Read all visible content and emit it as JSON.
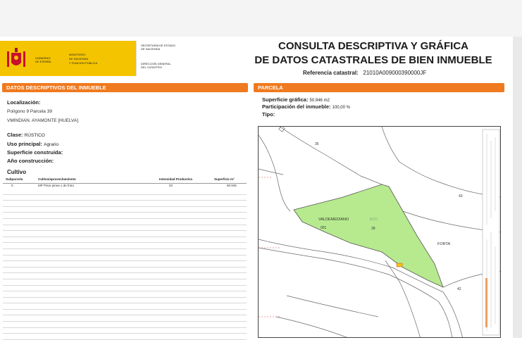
{
  "header": {
    "gov_line1": "GOBIERNO",
    "gov_line2": "DE ESPAÑA",
    "ministry_line1": "MINISTERIO",
    "ministry_line2": "DE HACIENDA",
    "ministry_line3": "Y FUNCIÓN PÚBLICA",
    "sec_line1": "SECRETARÍA DE ESTADO",
    "sec_line2": "DE HACIENDA",
    "dir_line1": "DIRECCIÓN GENERAL",
    "dir_line2": "DEL CATASTRO",
    "title_line1": "CONSULTA DESCRIPTIVA Y GRÁFICA",
    "title_line2": "DE DATOS CATASTRALES DE BIEN INMUEBLE",
    "ref_label": "Referencia catastral:",
    "ref_value": "21010A009000390000JF"
  },
  "left": {
    "section_title": "DATOS DESCRIPTIVOS DEL INMUEBLE",
    "loc_label": "Localización:",
    "loc_line1": "Polígono 9 Parcela 39",
    "loc_line2": "VMINDIAN. AYAMONTE [HUELVA]",
    "clase_label": "Clase:",
    "clase_value": "RÚSTICO",
    "uso_label": "Uso principal:",
    "uso_value": "Agrario",
    "sup_label": "Superficie construida:",
    "anio_label": "Año construcción:",
    "cultivo_title": "Cultivo",
    "cols": [
      "Subparcela",
      "Cultivo/aprovechamiento",
      "Intensidad Productiva",
      "Superficie m²"
    ],
    "row": [
      "0",
      "MP Pinar pinea o de fruto",
      "02",
      "50.946"
    ]
  },
  "right": {
    "section_title": "PARCELA",
    "sup_label": "Superficie gráfica:",
    "sup_value": "50.946 m2",
    "part_label": "Participación del inmueble:",
    "part_value": "100,00 %",
    "tipo_label": "Tipo:"
  },
  "map": {
    "labels": [
      "35",
      "43",
      "VALDEMEDIANO",
      "001",
      "ECO",
      "39",
      "FORTA",
      "42"
    ]
  },
  "colors": {
    "accent": "#f07a1f",
    "gov_yellow": "#f5c400",
    "parcel_fill": "#b7ea8f"
  }
}
